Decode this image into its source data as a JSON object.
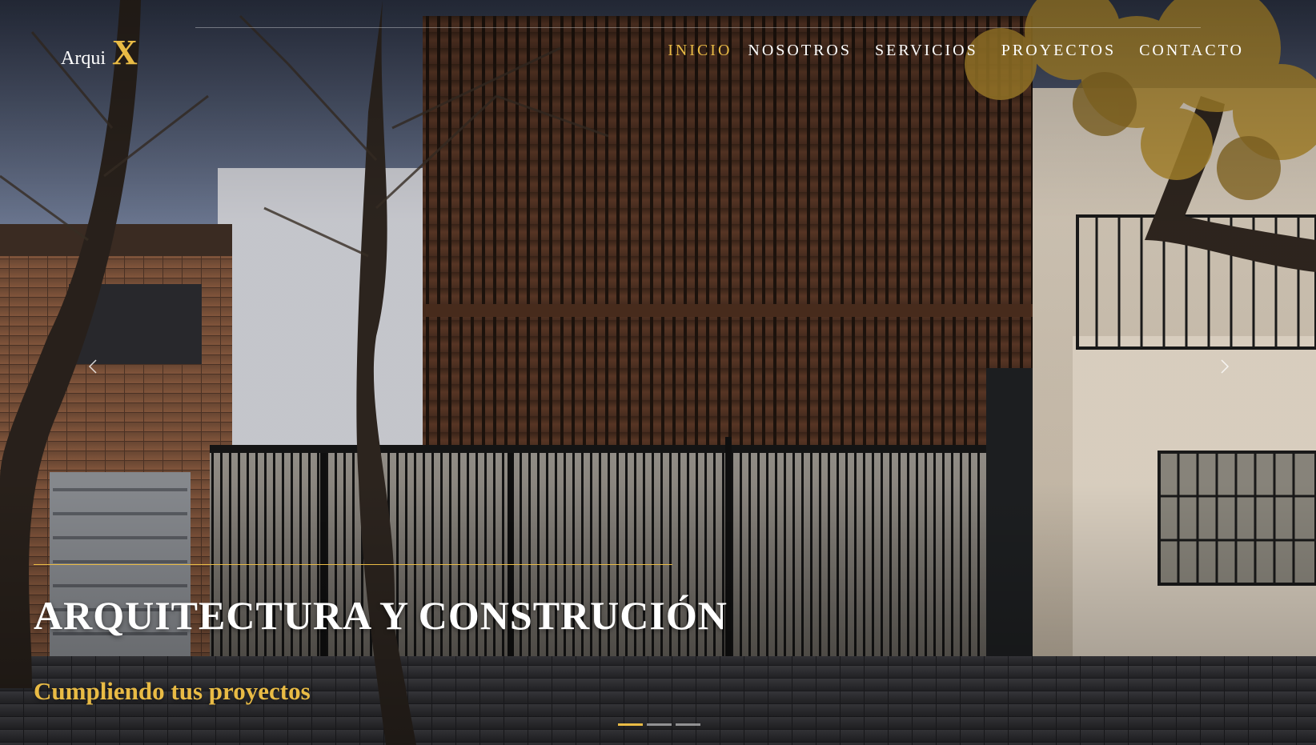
{
  "brand": {
    "name": "Arqui",
    "mark": "X"
  },
  "nav": {
    "items": [
      {
        "label": "INICIO",
        "active": true
      },
      {
        "label": "NOSOTROS",
        "active": false
      },
      {
        "label": "SERVICIOS",
        "active": false
      },
      {
        "label": "PROYECTOS",
        "active": false
      },
      {
        "label": "CONTACTO",
        "active": false
      }
    ]
  },
  "carousel": {
    "prev_icon": "chevron-left-icon",
    "next_icon": "chevron-right-icon",
    "slide_count": 3,
    "active_slide": 1
  },
  "hero": {
    "title": "ARQUITECTURA Y CONSTRUCIÓN",
    "subtitle": "Cumpliendo tus proyectos"
  },
  "colors": {
    "accent": "#e9bb45",
    "text": "#ffffff"
  }
}
